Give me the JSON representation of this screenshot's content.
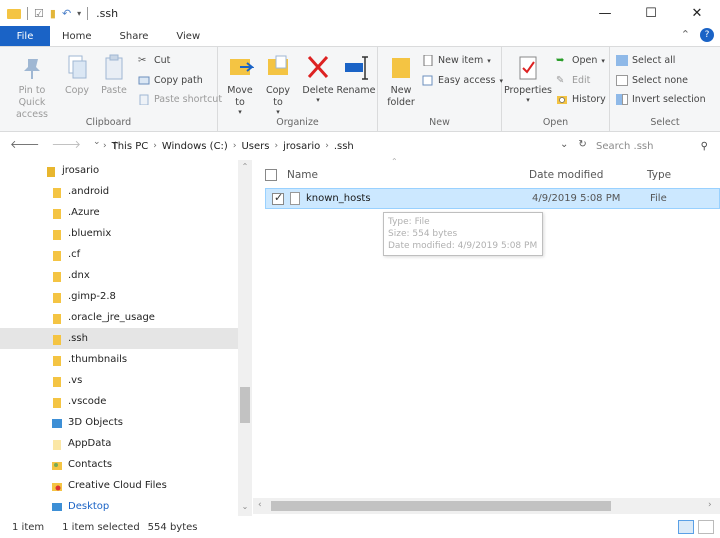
{
  "window": {
    "title": ".ssh",
    "min_glyph": "—",
    "max_glyph": "☐",
    "close_glyph": "✕"
  },
  "tabs": {
    "file": "File",
    "home": "Home",
    "share": "Share",
    "view": "View",
    "collapse_glyph": "⌃",
    "help_glyph": "?"
  },
  "ribbon": {
    "clipboard": {
      "pin_line1": "Pin to Quick",
      "pin_line2": "access",
      "copy": "Copy",
      "paste": "Paste",
      "cut": "Cut",
      "copy_path": "Copy path",
      "paste_shortcut": "Paste shortcut",
      "label": "Clipboard"
    },
    "organize": {
      "move_to": "Move to",
      "copy_to": "Copy to",
      "delete": "Delete",
      "rename": "Rename",
      "label": "Organize"
    },
    "new": {
      "new_folder_line1": "New",
      "new_folder_line2": "folder",
      "new_item": "New item",
      "easy_access": "Easy access",
      "label": "New"
    },
    "open": {
      "properties": "Properties",
      "open": "Open",
      "edit": "Edit",
      "history": "History",
      "label": "Open"
    },
    "select": {
      "select_all": "Select all",
      "select_none": "Select none",
      "invert_selection": "Invert selection",
      "label": "Select"
    }
  },
  "address": {
    "back_glyph": "🡐",
    "forward_glyph": "🡒",
    "recent_glyph": "⌄",
    "up_glyph": "🡑",
    "path": [
      "This PC",
      "Windows (C:)",
      "Users",
      "jrosario",
      ".ssh"
    ],
    "chevron": "›",
    "dropdown_glyph": "⌄",
    "refresh_glyph": "↻",
    "search_placeholder": "Search .ssh",
    "search_glyph": "⚲"
  },
  "nav": {
    "items": [
      {
        "label": "jrosario",
        "icon": "user-folder"
      },
      {
        "label": ".android",
        "icon": "folder"
      },
      {
        "label": ".Azure",
        "icon": "folder"
      },
      {
        "label": ".bluemix",
        "icon": "folder"
      },
      {
        "label": ".cf",
        "icon": "folder"
      },
      {
        "label": ".dnx",
        "icon": "folder"
      },
      {
        "label": ".gimp-2.8",
        "icon": "folder"
      },
      {
        "label": ".oracle_jre_usage",
        "icon": "folder"
      },
      {
        "label": ".ssh",
        "icon": "folder"
      },
      {
        "label": ".thumbnails",
        "icon": "folder"
      },
      {
        "label": ".vs",
        "icon": "folder"
      },
      {
        "label": ".vscode",
        "icon": "folder"
      },
      {
        "label": "3D Objects",
        "icon": "3d-objects"
      },
      {
        "label": "AppData",
        "icon": "folder-light"
      },
      {
        "label": "Contacts",
        "icon": "contacts"
      },
      {
        "label": "Creative Cloud Files",
        "icon": "creative-cloud"
      },
      {
        "label": "Desktop",
        "icon": "desktop"
      }
    ],
    "scroll_up_glyph": "⌃",
    "scroll_down_glyph": "⌄"
  },
  "content": {
    "columns": {
      "name": "Name",
      "date": "Date modified",
      "type": "Type"
    },
    "sort_glyph": "⌃",
    "files": [
      {
        "name": "known_hosts",
        "date": "4/9/2019 5:08 PM",
        "type": "File"
      }
    ],
    "tooltip": {
      "type": "Type: File",
      "size": "Size: 554 bytes",
      "date": "Date modified: 4/9/2019 5:08 PM"
    },
    "hscroll_left_glyph": "‹",
    "hscroll_right_glyph": "›"
  },
  "status": {
    "item_count": "1 item",
    "selected": "1 item selected",
    "size": "554 bytes"
  },
  "colors": {
    "accent": "#1a63c6",
    "selection": "#cce8ff",
    "folder": "#f4c443"
  }
}
